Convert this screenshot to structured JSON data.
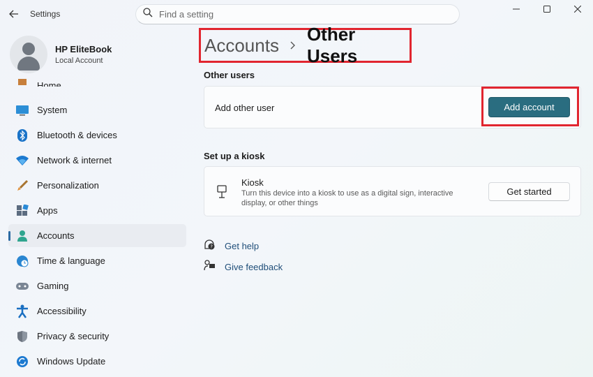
{
  "window": {
    "title": "Settings"
  },
  "search": {
    "placeholder": "Find a setting"
  },
  "profile": {
    "name": "HP EliteBook",
    "account_type": "Local Account"
  },
  "sidebar": {
    "items": [
      {
        "label": "Home",
        "icon": "home-icon"
      },
      {
        "label": "System",
        "icon": "system-icon"
      },
      {
        "label": "Bluetooth & devices",
        "icon": "bluetooth-icon"
      },
      {
        "label": "Network & internet",
        "icon": "wifi-icon"
      },
      {
        "label": "Personalization",
        "icon": "brush-icon"
      },
      {
        "label": "Apps",
        "icon": "apps-icon"
      },
      {
        "label": "Accounts",
        "icon": "accounts-icon",
        "active": true
      },
      {
        "label": "Time & language",
        "icon": "globe-clock-icon"
      },
      {
        "label": "Gaming",
        "icon": "gamepad-icon"
      },
      {
        "label": "Accessibility",
        "icon": "accessibility-icon"
      },
      {
        "label": "Privacy & security",
        "icon": "shield-icon"
      },
      {
        "label": "Windows Update",
        "icon": "update-icon"
      }
    ]
  },
  "breadcrumb": {
    "parent": "Accounts",
    "current": "Other Users"
  },
  "other_users": {
    "section_title": "Other users",
    "add_label": "Add other user",
    "add_button": "Add account"
  },
  "kiosk": {
    "section_title": "Set up a kiosk",
    "title": "Kiosk",
    "description": "Turn this device into a kiosk to use as a digital sign, interactive display, or other things",
    "button": "Get started"
  },
  "links": {
    "help": "Get help",
    "feedback": "Give feedback"
  },
  "colors": {
    "accent": "#2a6d80",
    "highlight_outline": "#e1252f",
    "active_indicator": "#2b6aa3"
  }
}
